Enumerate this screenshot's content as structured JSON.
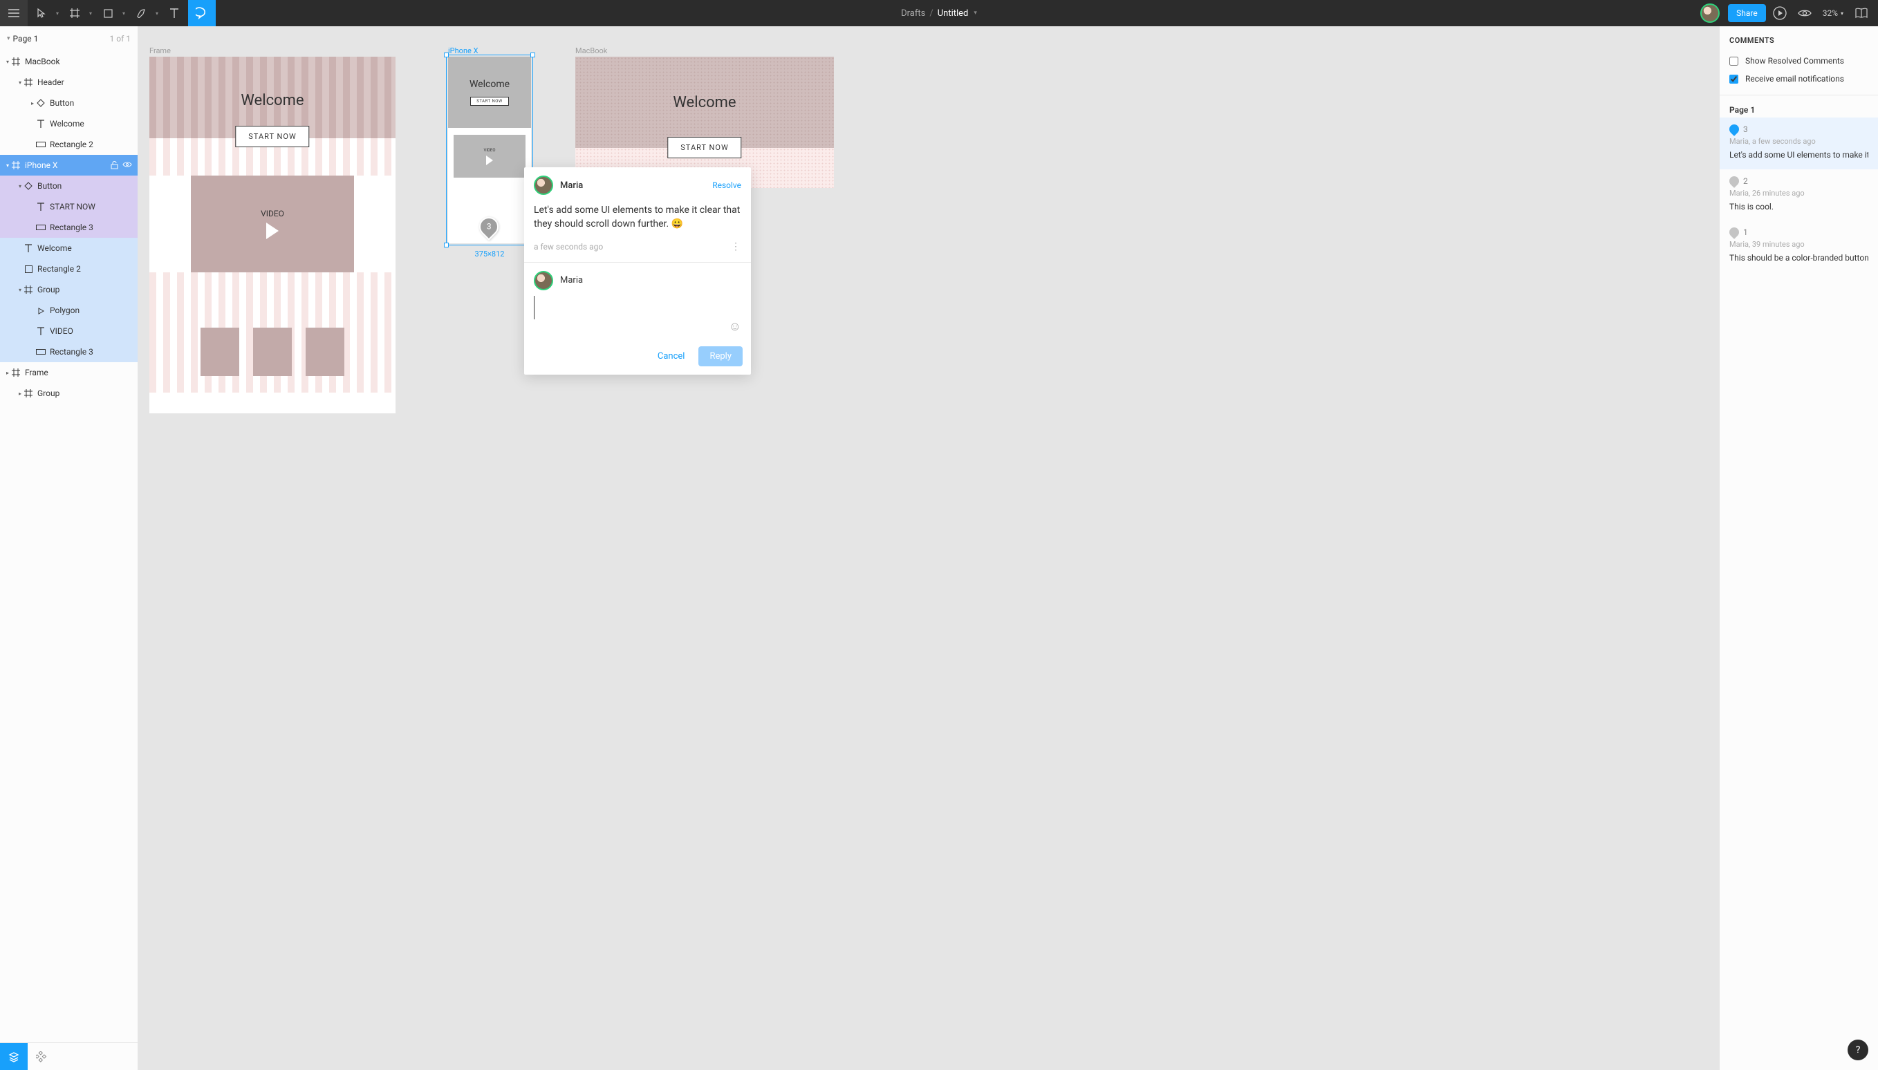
{
  "toolbar": {
    "drafts_label": "Drafts",
    "doc_title": "Untitled",
    "share_label": "Share",
    "zoom": "32%"
  },
  "pages": {
    "current_name": "Page 1",
    "indicator": "1 of 1"
  },
  "layers": [
    {
      "depth": 0,
      "exp": "▾",
      "icon": "frame",
      "label": "MacBook"
    },
    {
      "depth": 1,
      "exp": "▾",
      "icon": "frame",
      "label": "Header"
    },
    {
      "depth": 2,
      "exp": "▸",
      "icon": "diamond",
      "label": "Button"
    },
    {
      "depth": 2,
      "exp": "",
      "icon": "text",
      "label": "Welcome"
    },
    {
      "depth": 2,
      "exp": "",
      "icon": "rect",
      "label": "Rectangle 2"
    },
    {
      "depth": 0,
      "exp": "▾",
      "icon": "frame",
      "label": "iPhone X",
      "sel": "blue",
      "locked": true,
      "visible": true
    },
    {
      "depth": 1,
      "exp": "▾",
      "icon": "diamond",
      "label": "Button",
      "sel": "lav"
    },
    {
      "depth": 2,
      "exp": "",
      "icon": "text",
      "label": "START NOW",
      "sel": "lav"
    },
    {
      "depth": 2,
      "exp": "",
      "icon": "rect",
      "label": "Rectangle 3",
      "sel": "lav"
    },
    {
      "depth": 1,
      "exp": "",
      "icon": "text",
      "label": "Welcome",
      "sel": "bluelight"
    },
    {
      "depth": 1,
      "exp": "",
      "icon": "square",
      "label": "Rectangle 2",
      "sel": "bluelight"
    },
    {
      "depth": 1,
      "exp": "▾",
      "icon": "frame",
      "label": "Group",
      "sel": "bluelight"
    },
    {
      "depth": 2,
      "exp": "",
      "icon": "poly",
      "label": "Polygon",
      "sel": "bluelight"
    },
    {
      "depth": 2,
      "exp": "",
      "icon": "text",
      "label": "VIDEO",
      "sel": "bluelight"
    },
    {
      "depth": 2,
      "exp": "",
      "icon": "rect",
      "label": "Rectangle 3",
      "sel": "bluelight"
    },
    {
      "depth": 0,
      "exp": "▸",
      "icon": "frame",
      "label": "Frame"
    },
    {
      "depth": 1,
      "exp": "▸",
      "icon": "frame",
      "label": "Group"
    }
  ],
  "canvas": {
    "frame1_label": "Frame",
    "iphone_label": "iPhone X",
    "macbook_label": "MacBook",
    "welcome": "Welcome",
    "start_now": "START NOW",
    "video": "VIDEO",
    "iphone_dims": "375×812",
    "pin_number": "3"
  },
  "popup": {
    "author": "Maria",
    "resolve": "Resolve",
    "body": "Let's add some UI elements to make it clear that they should scroll down further. 😀",
    "timestamp": "a few seconds ago",
    "reply_author": "Maria",
    "cancel": "Cancel",
    "reply": "Reply"
  },
  "comments_panel": {
    "title": "COMMENTS",
    "show_resolved": "Show Resolved Comments",
    "email_notif": "Receive email notifications",
    "section": "Page 1",
    "threads": [
      {
        "num": "3",
        "meta": "Maria, a few seconds ago",
        "text": "Let's add some UI elements to make it",
        "active": true
      },
      {
        "num": "2",
        "meta": "Maria, 26 minutes ago",
        "text": "This is cool."
      },
      {
        "num": "1",
        "meta": "Maria, 39 minutes ago",
        "text": "This should be a color-branded button"
      }
    ]
  }
}
